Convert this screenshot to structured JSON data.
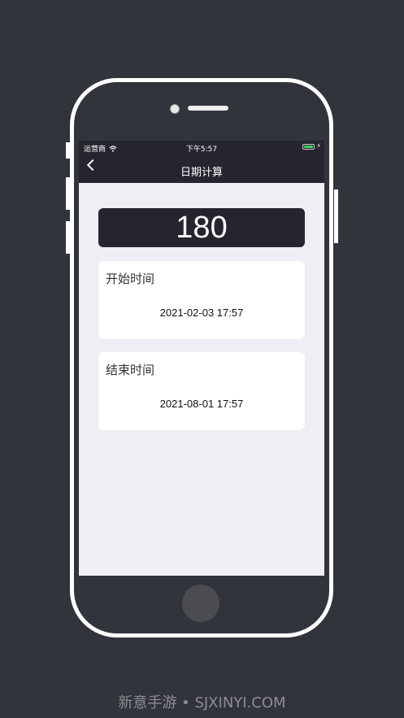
{
  "status_bar": {
    "carrier": "运营商",
    "time": "下午5:57",
    "wifi_icon": "wifi-icon",
    "battery_color": "#3fd05a"
  },
  "nav": {
    "title": "日期计算",
    "back_icon": "chevron-left-icon"
  },
  "result": {
    "value": "180"
  },
  "start": {
    "label": "开始时间",
    "value": "2021-02-03 17:57"
  },
  "end": {
    "label": "结束时间",
    "value": "2021-08-01 17:57"
  },
  "watermark": "新意手游 • SJXINYI.COM",
  "colors": {
    "dark": "#26252f",
    "background": "#efeef4",
    "page": "#31343b"
  }
}
